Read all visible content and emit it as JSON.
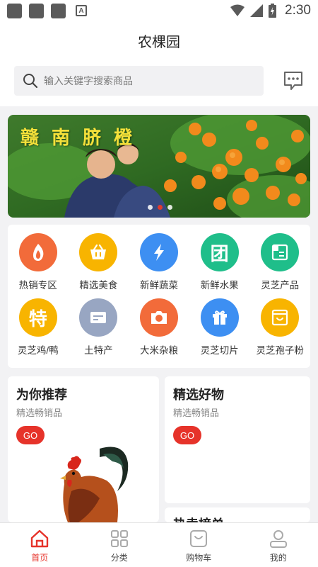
{
  "status": {
    "time": "2:30",
    "notif_letter": "A"
  },
  "header": {
    "title": "农棵园"
  },
  "search": {
    "placeholder": "输入关键字搜索商品"
  },
  "banner": {
    "title": "赣南脐橙",
    "slides": 3,
    "active_slide": 2
  },
  "categories": [
    {
      "label": "热销专区",
      "icon": "fire-icon",
      "color": "#f26b3a"
    },
    {
      "label": "精选美食",
      "icon": "basket-icon",
      "color": "#f8b400"
    },
    {
      "label": "新鲜蔬菜",
      "icon": "lightning-icon",
      "color": "#3d8ff2"
    },
    {
      "label": "新鲜水果",
      "icon": "group-icon",
      "color": "#1fbe8a",
      "glyph": "团"
    },
    {
      "label": "灵芝产品",
      "icon": "store-icon",
      "color": "#1fbe8a"
    },
    {
      "label": "灵芝鸡/鸭",
      "icon": "special-icon",
      "color": "#f8b400",
      "glyph": "特"
    },
    {
      "label": "土特产",
      "icon": "card-icon",
      "color": "#98a6c2"
    },
    {
      "label": "大米杂粮",
      "icon": "camera-icon",
      "color": "#f26b3a"
    },
    {
      "label": "灵芝切片",
      "icon": "gift-icon",
      "color": "#3d8ff2"
    },
    {
      "label": "灵芝孢子粉",
      "icon": "smile-box-icon",
      "color": "#f8b400"
    }
  ],
  "recommend": {
    "left": {
      "title": "为你推荐",
      "subtitle": "精选畅销品",
      "button": "GO"
    },
    "right": {
      "title": "精选好物",
      "subtitle": "精选畅销品",
      "button": "GO"
    },
    "partial": {
      "title": "热卖榜单"
    }
  },
  "tabs": [
    {
      "label": "首页",
      "icon": "home-icon",
      "active": true
    },
    {
      "label": "分类",
      "icon": "category-icon",
      "active": false
    },
    {
      "label": "购物车",
      "icon": "cart-icon",
      "active": false
    },
    {
      "label": "我的",
      "icon": "profile-icon",
      "active": false
    }
  ],
  "colors": {
    "accent": "#e6332a",
    "background": "#f2f2f4"
  }
}
